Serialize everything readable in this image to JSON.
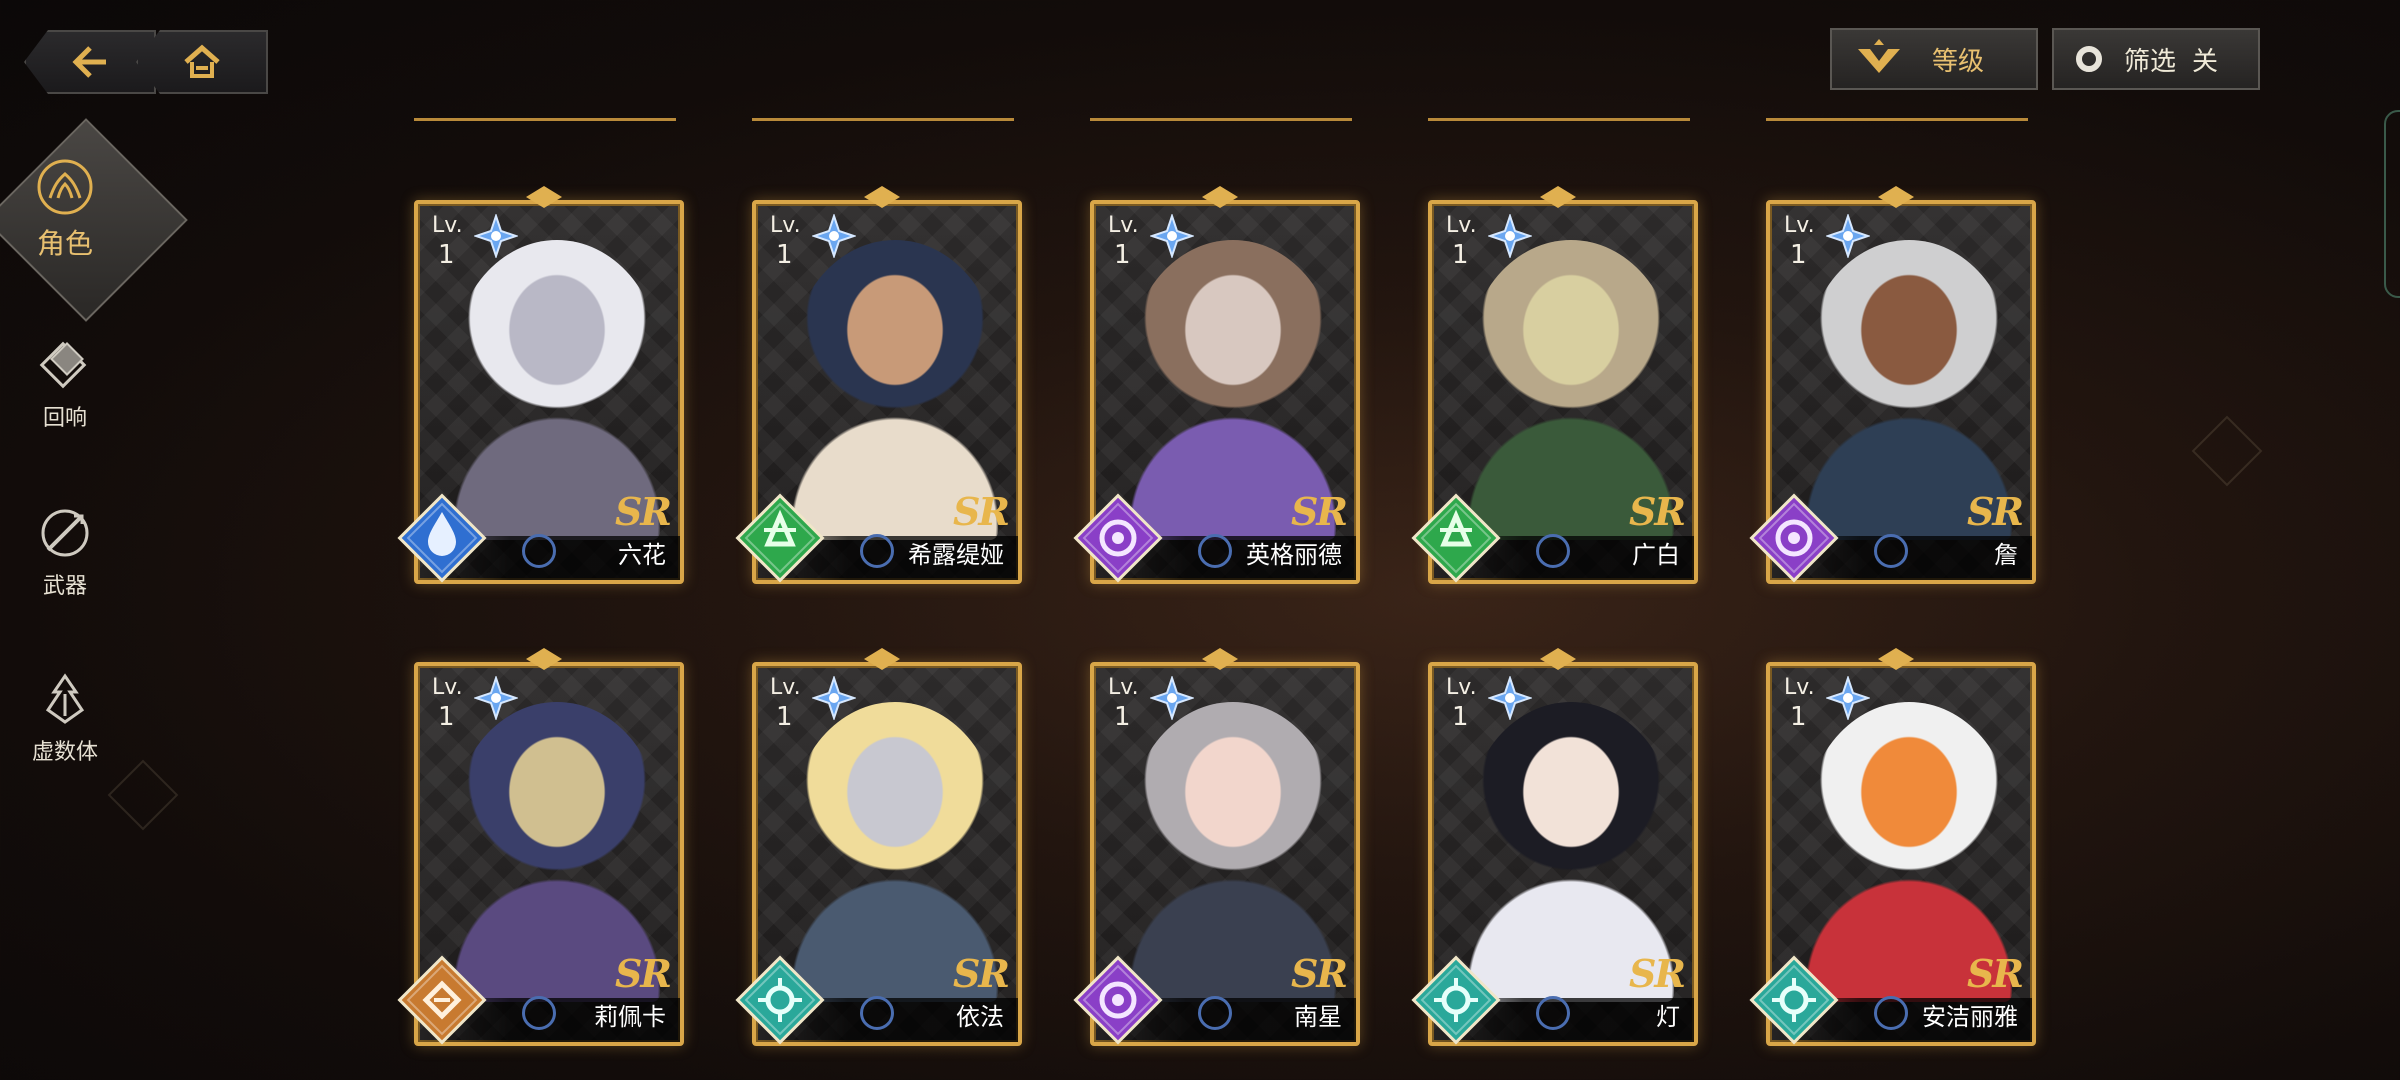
{
  "nav": {
    "back_icon": "back-arrow-icon",
    "home_icon": "home-icon"
  },
  "controls": {
    "sort_label": "等级",
    "filter_label": "筛选",
    "filter_state": "关"
  },
  "sidebar": {
    "items": [
      {
        "label": "角色",
        "icon": "character-icon",
        "active": true
      },
      {
        "label": "回响",
        "icon": "echo-icon",
        "active": false
      },
      {
        "label": "武器",
        "icon": "weapon-icon",
        "active": false
      },
      {
        "label": "虚数体",
        "icon": "imaginary-icon",
        "active": false
      }
    ]
  },
  "cards": [
    {
      "lv_label": "Lv.",
      "level": "1",
      "rarity": "SR",
      "name": "六花",
      "element": "water",
      "element_color": "#2f6fd1",
      "portrait": [
        "#e8e8ee",
        "#b9b8c6",
        "#6f6a7e"
      ]
    },
    {
      "lv_label": "Lv.",
      "level": "1",
      "rarity": "SR",
      "name": "希露缇娅",
      "element": "wind",
      "element_color": "#2ea84c",
      "portrait": [
        "#2a3550",
        "#c89a78",
        "#e8dccb"
      ]
    },
    {
      "lv_label": "Lv.",
      "level": "1",
      "rarity": "SR",
      "name": "英格丽德",
      "element": "void",
      "element_color": "#8a3fc7",
      "portrait": [
        "#8a6f5e",
        "#d8c8c0",
        "#7a5cb0"
      ]
    },
    {
      "lv_label": "Lv.",
      "level": "1",
      "rarity": "SR",
      "name": "广白",
      "element": "wind",
      "element_color": "#2ea84c",
      "portrait": [
        "#b8a88a",
        "#d8cfa0",
        "#3a5a3a"
      ]
    },
    {
      "lv_label": "Lv.",
      "level": "1",
      "rarity": "SR",
      "name": "詹",
      "element": "void",
      "element_color": "#8a3fc7",
      "portrait": [
        "#cfcfd0",
        "#8a5a40",
        "#2e3f55"
      ]
    },
    {
      "lv_label": "Lv.",
      "level": "1",
      "rarity": "SR",
      "name": "莉佩卡",
      "element": "earth",
      "element_color": "#c87a30",
      "portrait": [
        "#3a3f6a",
        "#d0bf90",
        "#5a4a80"
      ]
    },
    {
      "lv_label": "Lv.",
      "level": "1",
      "rarity": "SR",
      "name": "依法",
      "element": "light",
      "element_color": "#2aa89a",
      "portrait": [
        "#f0dc9a",
        "#c8c8d0",
        "#4a5a70"
      ]
    },
    {
      "lv_label": "Lv.",
      "level": "1",
      "rarity": "SR",
      "name": "南星",
      "element": "void",
      "element_color": "#8a3fc7",
      "portrait": [
        "#b0acb0",
        "#f2d6cc",
        "#3a4050"
      ]
    },
    {
      "lv_label": "Lv.",
      "level": "1",
      "rarity": "SR",
      "name": "灯",
      "element": "light",
      "element_color": "#2aa89a",
      "portrait": [
        "#1c1c24",
        "#f2e2d8",
        "#e8e8f0"
      ]
    },
    {
      "lv_label": "Lv.",
      "level": "1",
      "rarity": "SR",
      "name": "安洁丽雅",
      "element": "light",
      "element_color": "#2aa89a",
      "portrait": [
        "#f0f0f0",
        "#f08a3a",
        "#c8323a"
      ]
    }
  ]
}
